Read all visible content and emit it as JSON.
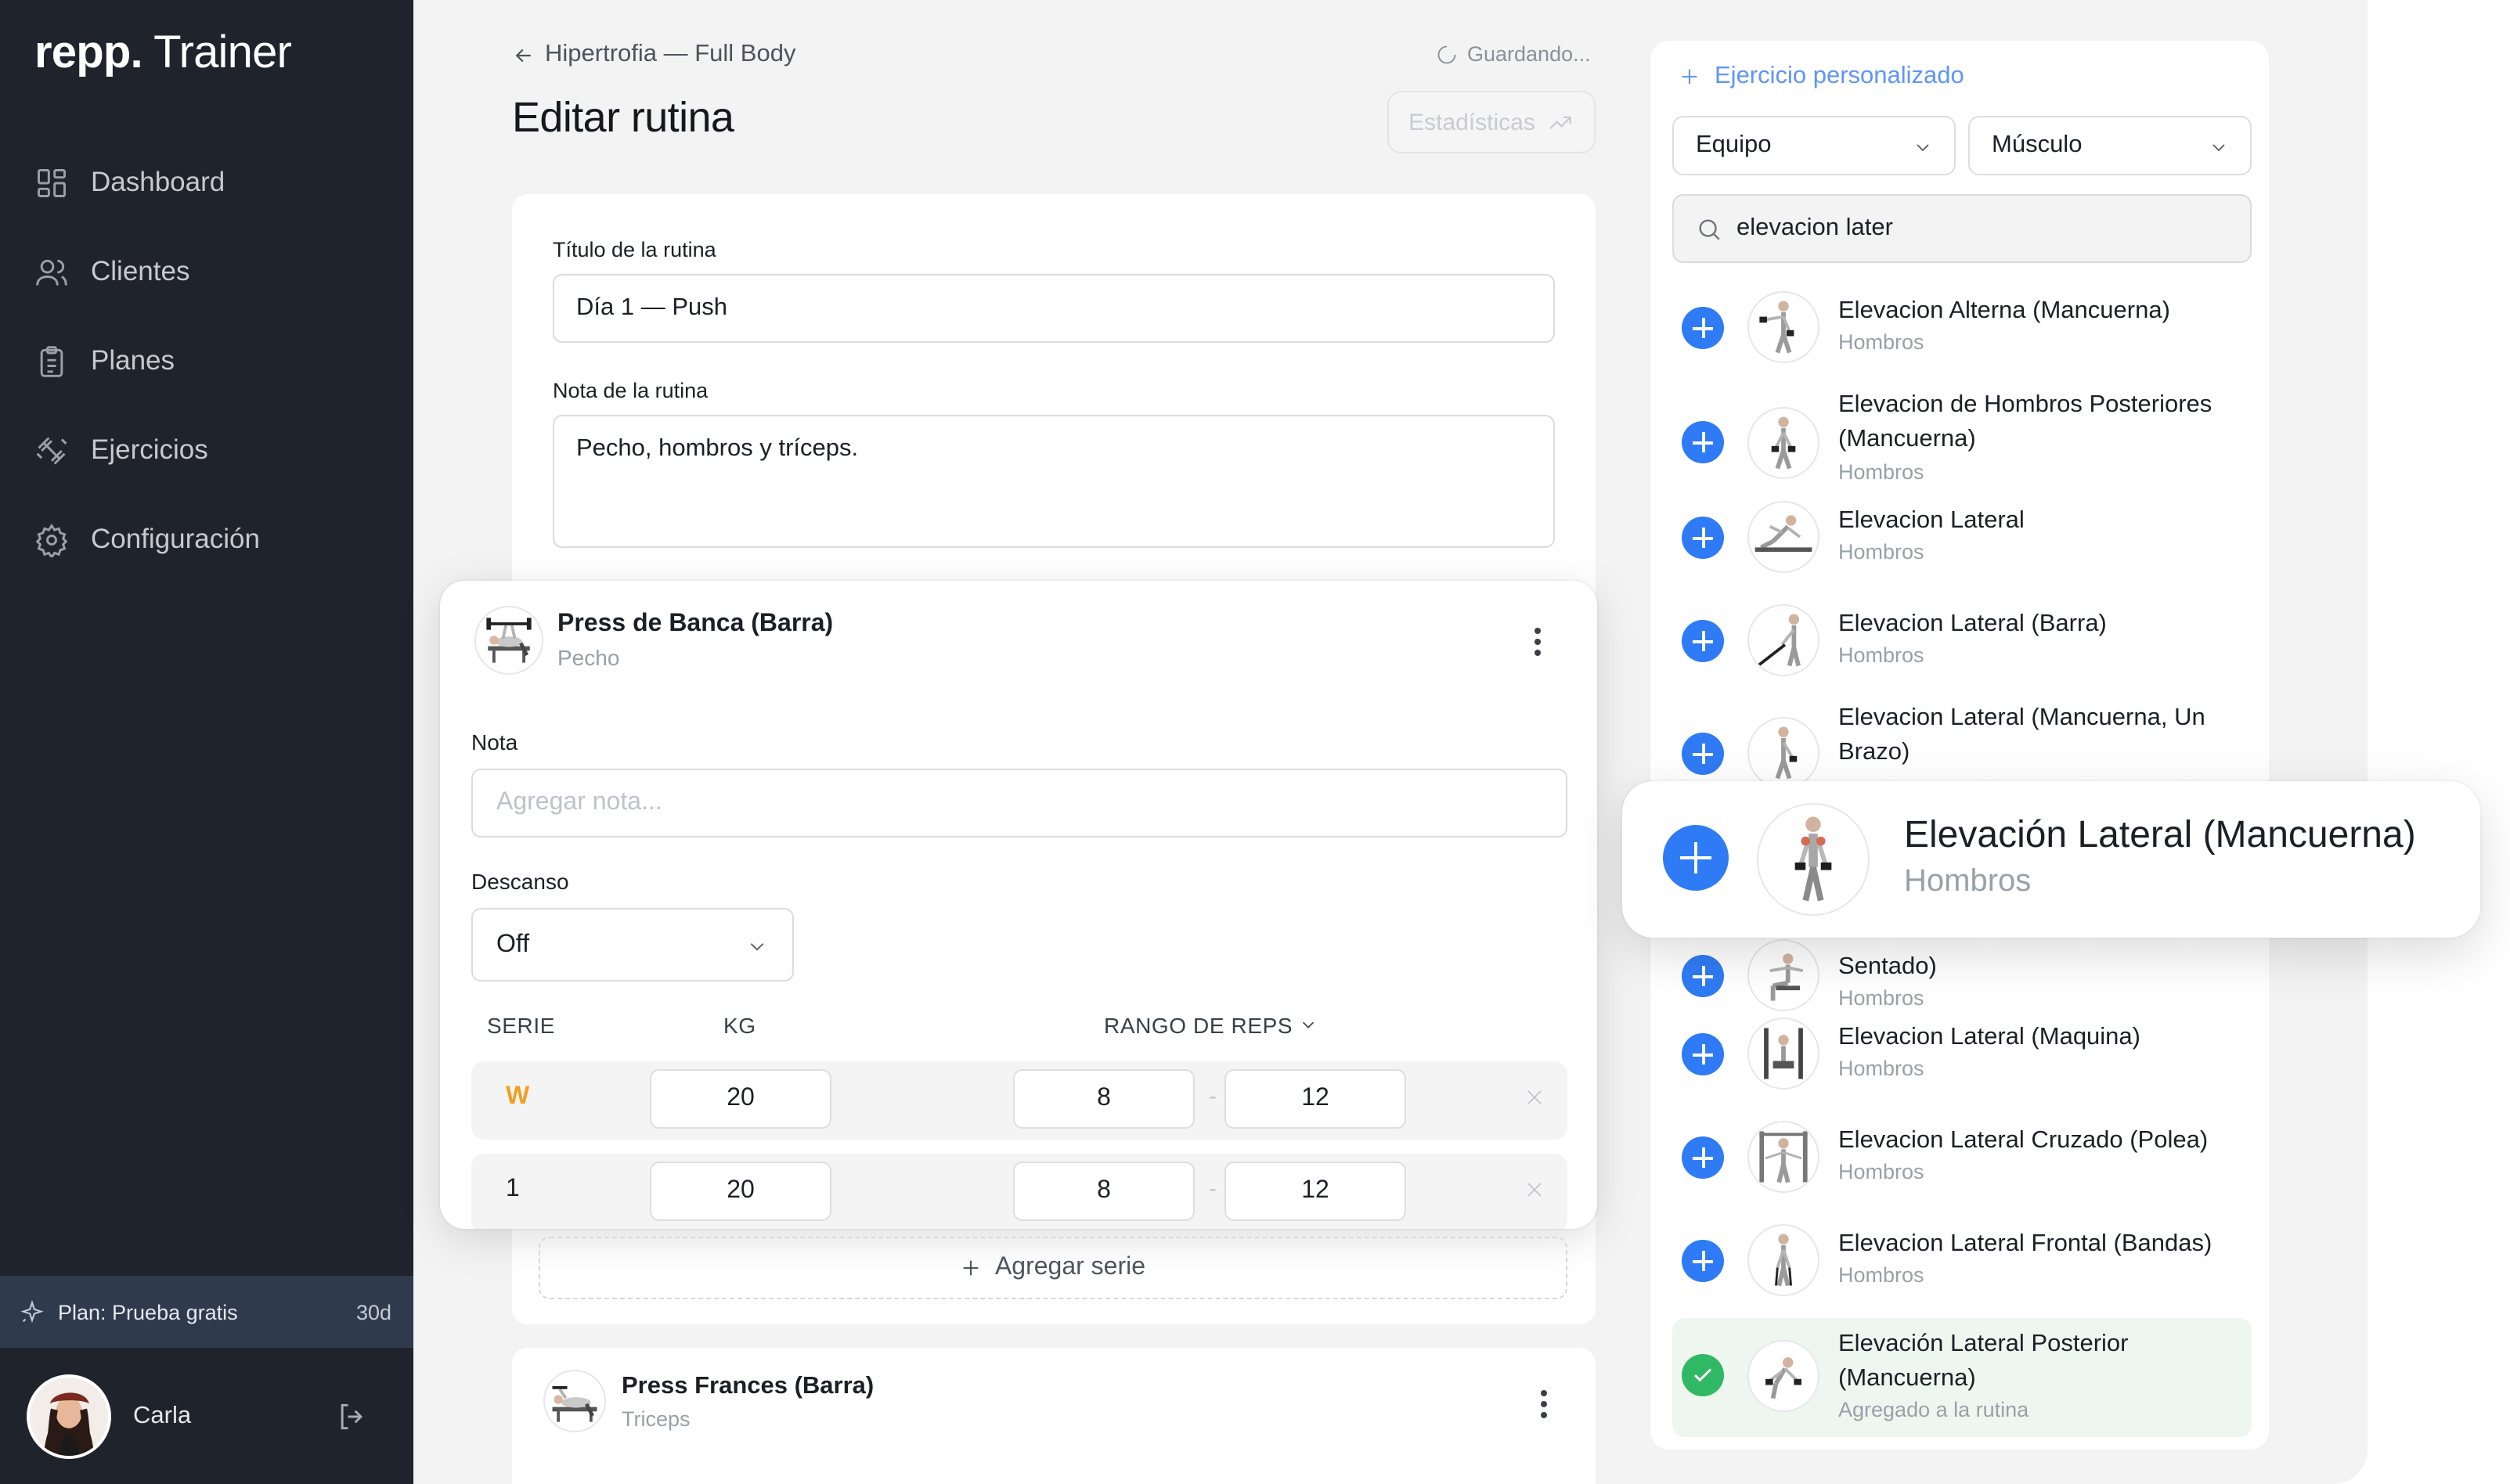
{
  "sidebar": {
    "logo_bold": "repp.",
    "logo_light": "Trainer",
    "nav": [
      {
        "label": "Dashboard",
        "icon": "dashboard-icon"
      },
      {
        "label": "Clientes",
        "icon": "users-icon"
      },
      {
        "label": "Planes",
        "icon": "clipboard-icon"
      },
      {
        "label": "Ejercicios",
        "icon": "dumbbell-icon"
      },
      {
        "label": "Configuración",
        "icon": "gear-icon"
      }
    ],
    "plan_label": "Plan: Prueba gratis",
    "plan_days": "30d",
    "user_name": "Carla"
  },
  "header": {
    "back_label": "Hipertrofia — Full Body",
    "title": "Editar rutina",
    "saving_status": "Guardando...",
    "stats_button": "Estadísticas"
  },
  "routine": {
    "title_label": "Título de la rutina",
    "title_value": "Día 1 — Push",
    "note_label": "Nota de la rutina",
    "note_value": "Pecho, hombros y tríceps."
  },
  "exercise": {
    "name": "Press de Banca (Barra)",
    "muscle": "Pecho",
    "note_label": "Nota",
    "note_placeholder": "Agregar nota...",
    "rest_label": "Descanso",
    "rest_value": "Off",
    "col_set": "SERIE",
    "col_kg": "KG",
    "col_reps": "RANGO DE REPS",
    "sets": [
      {
        "set": "W",
        "kg": "20",
        "min": "8",
        "max": "12",
        "warmup": true
      },
      {
        "set": "1",
        "kg": "20",
        "min": "8",
        "max": "12",
        "warmup": false
      }
    ],
    "range_sep": "-",
    "add_set_label": "Agregar serie"
  },
  "exercise2": {
    "name": "Press Frances (Barra)",
    "muscle": "Triceps"
  },
  "library": {
    "custom_label": "Ejercicio personalizado",
    "filter_equipment": "Equipo",
    "filter_muscle": "Músculo",
    "search_value": "elevacion later",
    "items": [
      {
        "name": "Elevacion Alterna (Mancuerna)",
        "muscle": "Hombros"
      },
      {
        "name": "Elevacion de Hombros Posteriores (Mancuerna)",
        "muscle": "Hombros"
      },
      {
        "name": "Elevacion Lateral",
        "muscle": "Hombros"
      },
      {
        "name": "Elevacion Lateral (Barra)",
        "muscle": "Hombros"
      },
      {
        "name": "Elevacion Lateral (Mancuerna, Un Brazo)",
        "muscle": ""
      },
      {
        "name": "Sentado)",
        "muscle": "Hombros"
      },
      {
        "name": "Elevacion Lateral (Maquina)",
        "muscle": "Hombros"
      },
      {
        "name": "Elevacion Lateral Cruzado (Polea)",
        "muscle": "Hombros"
      },
      {
        "name": "Elevacion Lateral Frontal (Bandas)",
        "muscle": "Hombros"
      }
    ],
    "added_item": {
      "name": "Elevación Lateral Posterior (Mancuerna)",
      "status": "Agregado a la rutina"
    }
  },
  "floating_card": {
    "name": "Elevación Lateral (Mancuerna)",
    "muscle": "Hombros"
  }
}
